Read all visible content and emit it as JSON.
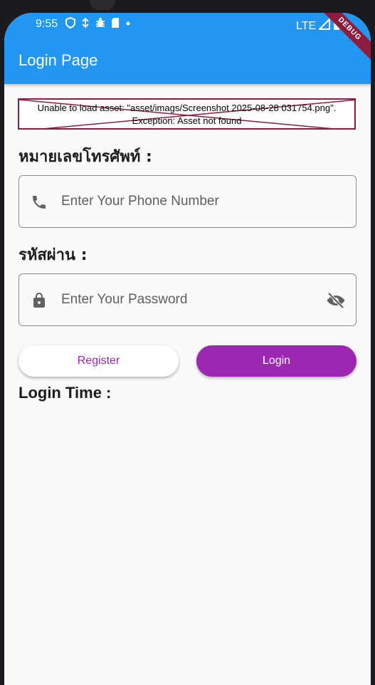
{
  "status_bar": {
    "time": "9:55",
    "network": "LTE"
  },
  "app_bar": {
    "title": "Login Page",
    "debug_banner": "DEBUG"
  },
  "error": {
    "line1": "Unable to load asset: \"asset/imags/Screenshot 2025-08-28 031754.png\".",
    "line2": "Exception: Asset not found"
  },
  "phone": {
    "label": "หมายเลขโทรศัพท์ :",
    "placeholder": "Enter Your Phone Number",
    "icon": "phone-icon"
  },
  "password": {
    "label": "รหัสผ่าน :",
    "placeholder": "Enter Your Password",
    "icon": "lock-icon",
    "toggle_icon": "visibility-off-icon"
  },
  "buttons": {
    "register": "Register",
    "login": "Login"
  },
  "login_time": {
    "label": "Login Time :"
  },
  "colors": {
    "app_bar": "#2196f3",
    "primary_button": "#9c27b0",
    "error_border": "#8b1e3f"
  }
}
